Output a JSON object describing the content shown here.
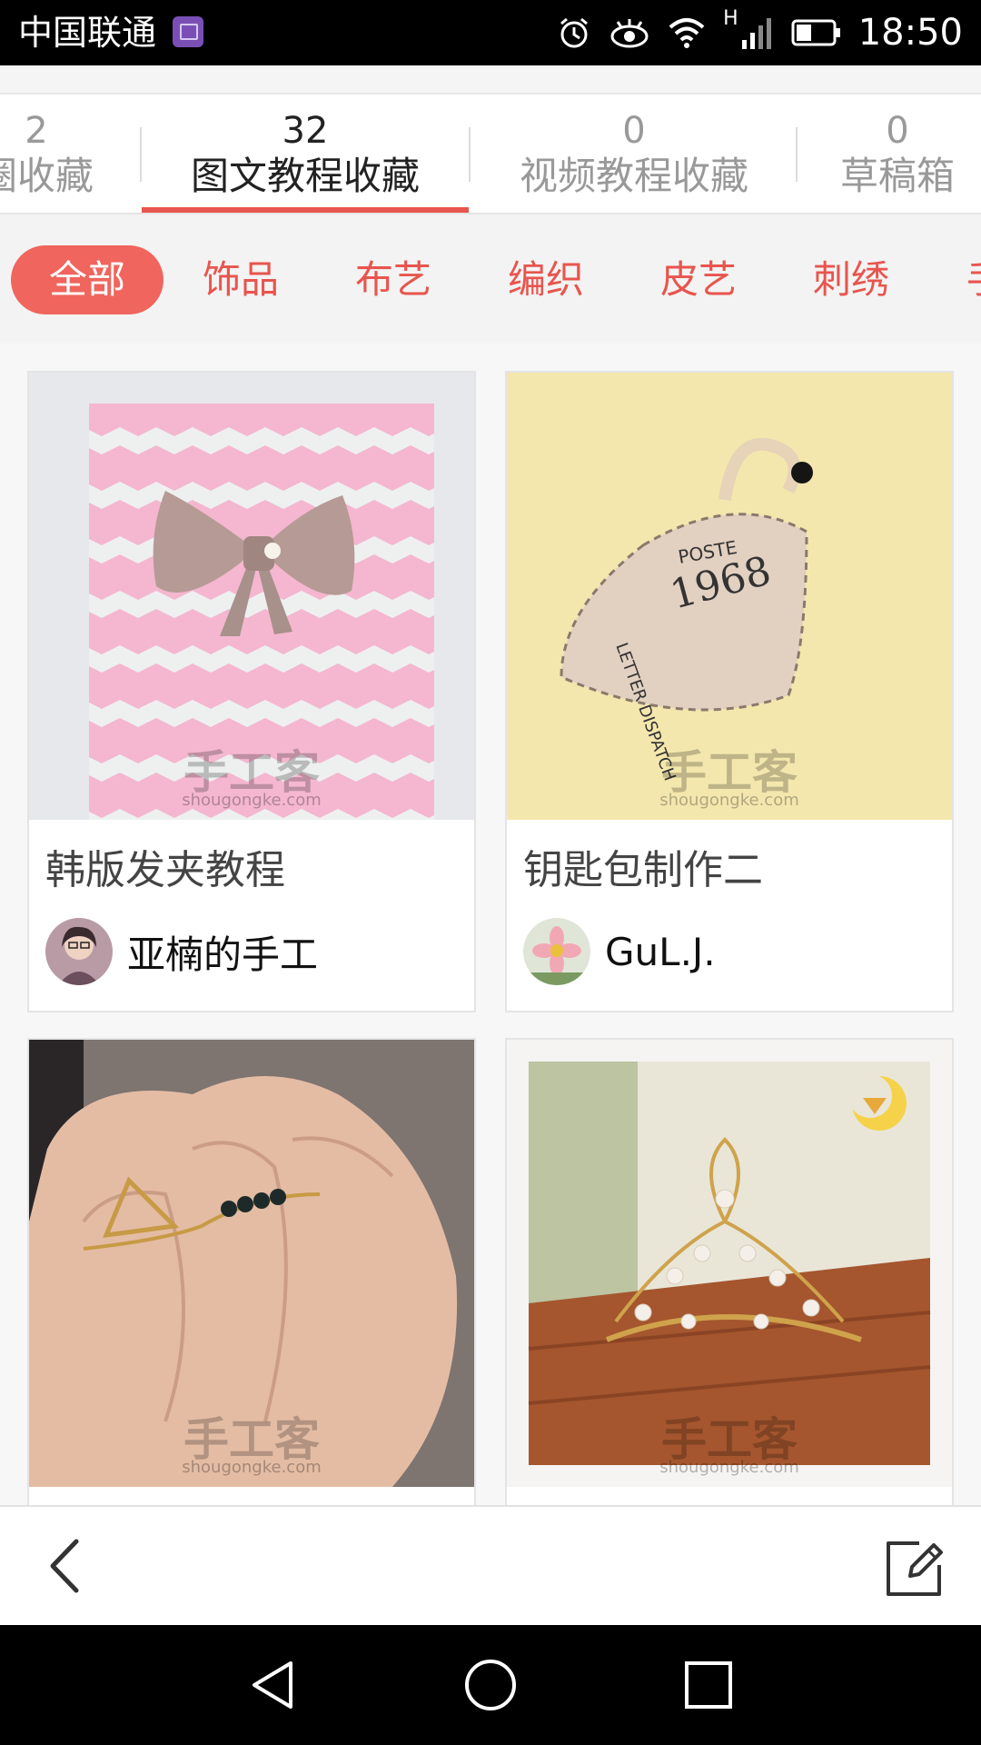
{
  "status_bar": {
    "carrier": "中国联通",
    "time": "18:50",
    "network_label": "H",
    "icons": [
      "gallery-notification-icon",
      "alarm-icon",
      "eye-icon",
      "wifi-icon",
      "signal-icon",
      "battery-icon"
    ]
  },
  "collection_tabs": [
    {
      "count": "2",
      "label": "圈收藏"
    },
    {
      "count": "32",
      "label": "图文教程收藏",
      "active": true
    },
    {
      "count": "0",
      "label": "视频教程收藏"
    },
    {
      "count": "0",
      "label": "草稿箱"
    }
  ],
  "categories": [
    {
      "label": "全部",
      "active": true
    },
    {
      "label": "饰品"
    },
    {
      "label": "布艺"
    },
    {
      "label": "编织"
    },
    {
      "label": "皮艺"
    },
    {
      "label": "刺绣"
    },
    {
      "label": "手"
    }
  ],
  "cards": [
    {
      "title": "韩版发夹教程",
      "author": "亚楠的手工"
    },
    {
      "title": "钥匙包制作二",
      "author": "GuL.J."
    },
    {
      "title": "",
      "author": ""
    },
    {
      "title": "",
      "author": ""
    }
  ],
  "watermark": {
    "main": "手工客",
    "sub": "shougongke.com"
  },
  "colors": {
    "accent": "#e8554e",
    "chip_active_bg": "#f0655d"
  }
}
